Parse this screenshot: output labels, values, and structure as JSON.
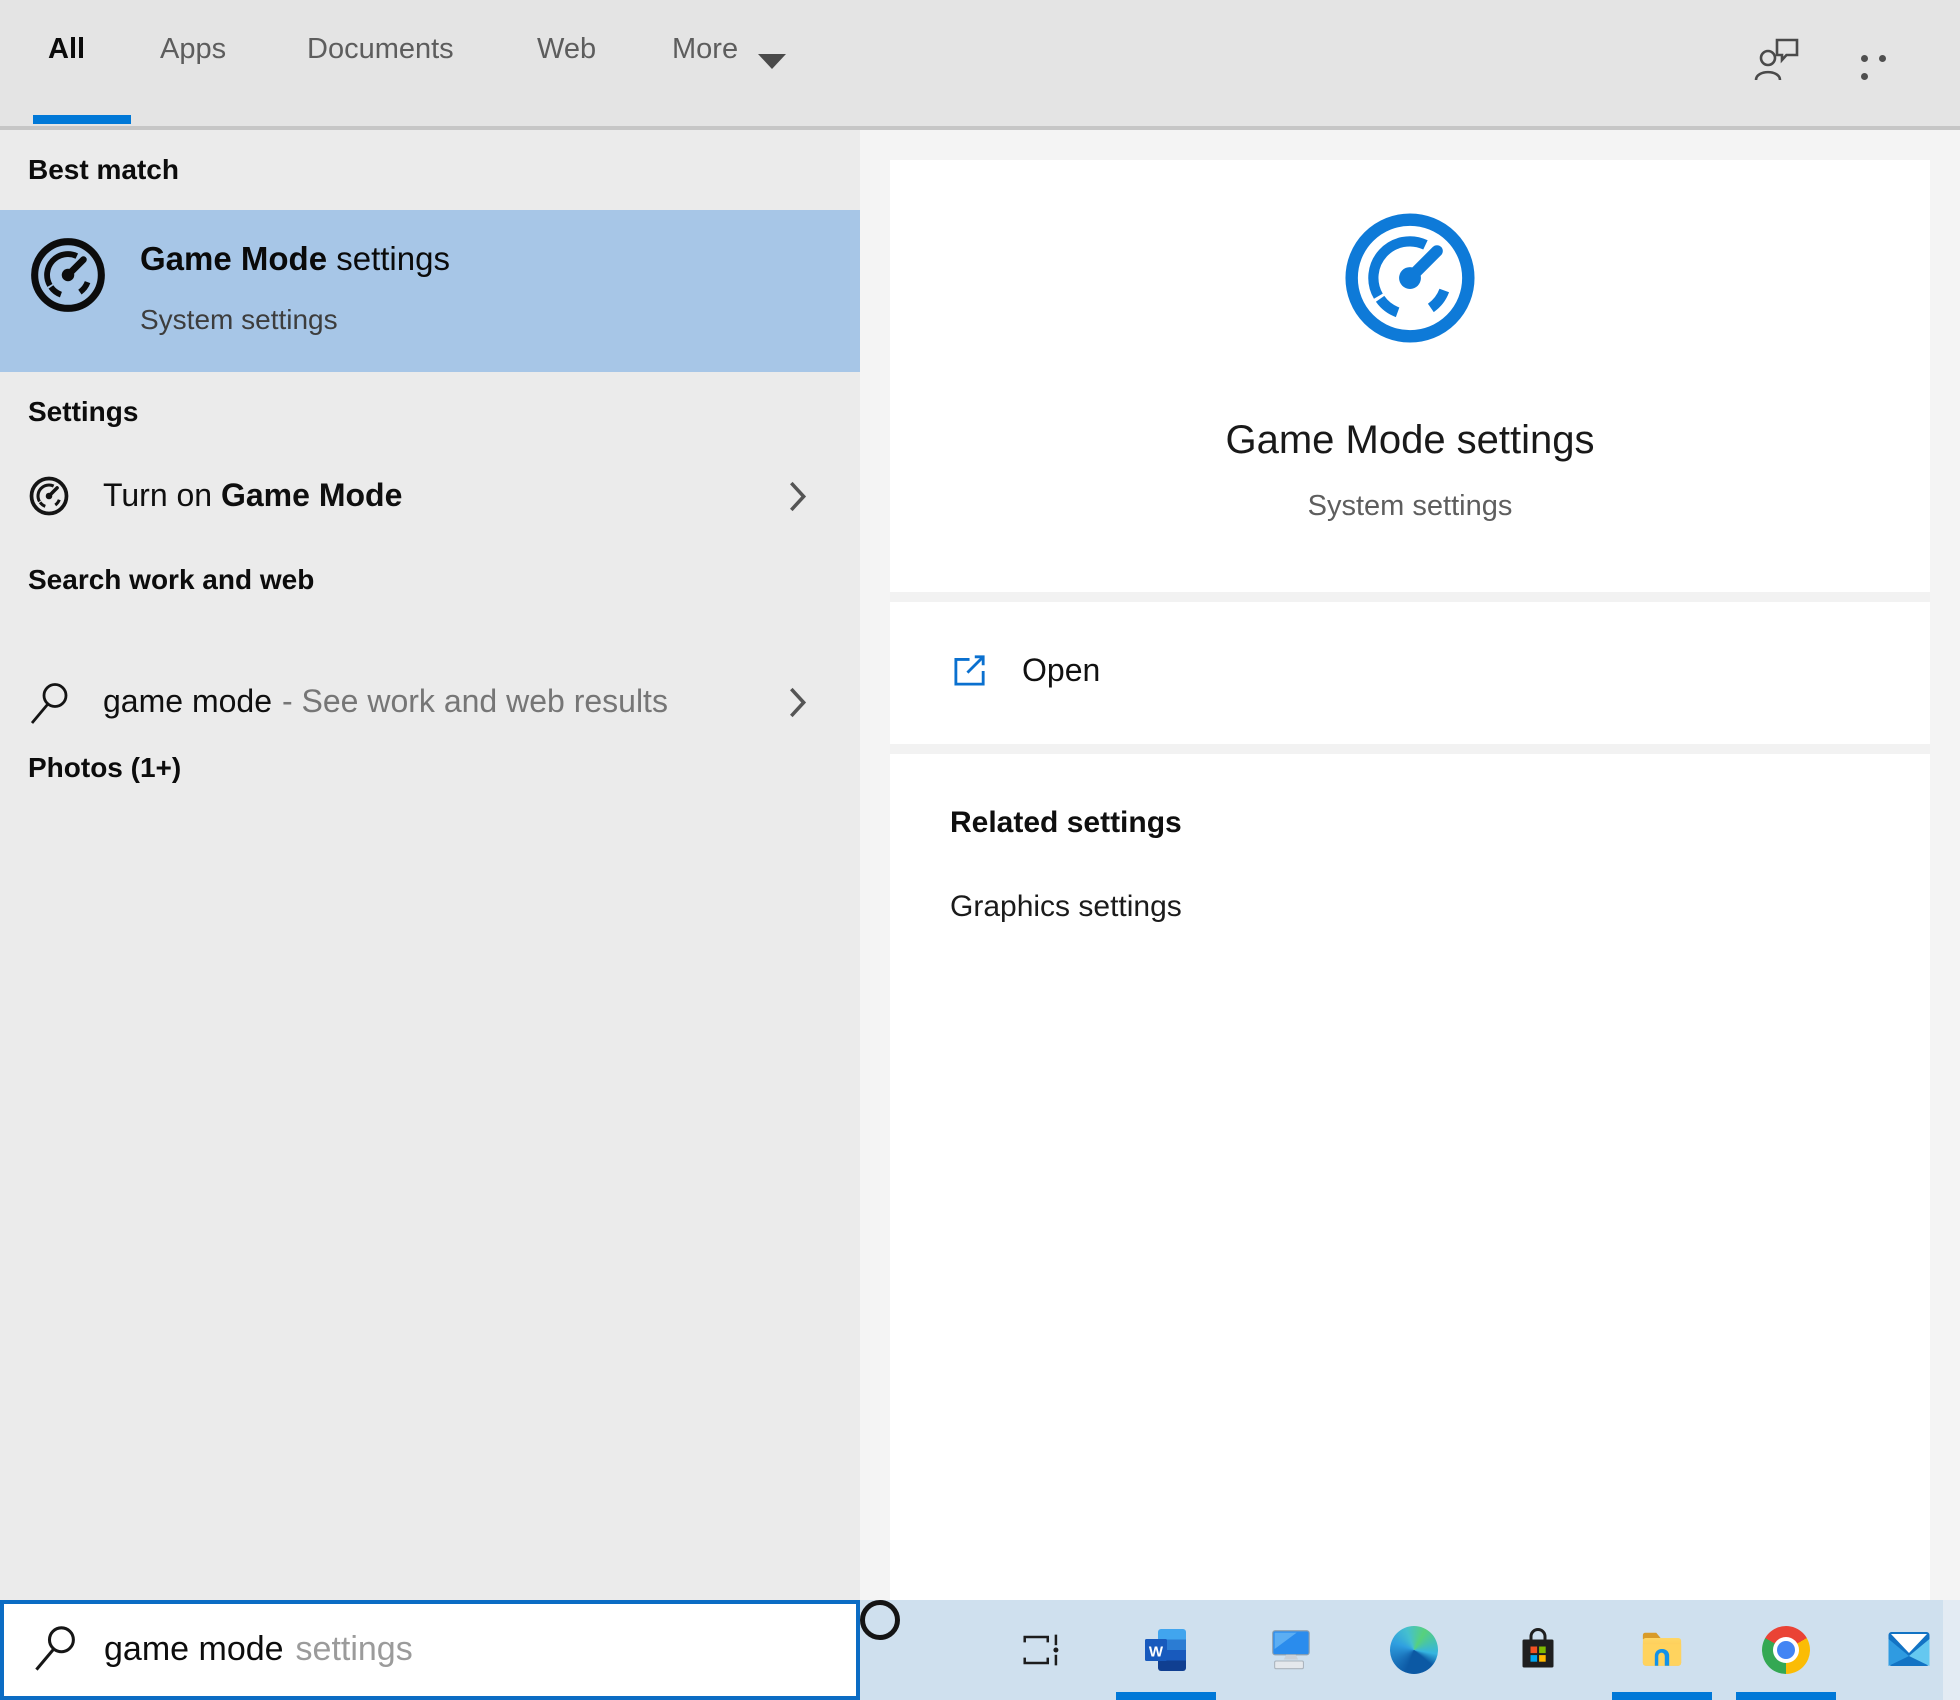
{
  "header": {
    "tabs": [
      {
        "label": "All",
        "active": true
      },
      {
        "label": "Apps",
        "active": false
      },
      {
        "label": "Documents",
        "active": false
      },
      {
        "label": "Web",
        "active": false
      },
      {
        "label": "More",
        "active": false
      }
    ]
  },
  "left_panel": {
    "best_match_header": "Best match",
    "best_match": {
      "title_bold": "Game Mode",
      "title_rest": " settings",
      "subtitle": "System settings"
    },
    "settings_header": "Settings",
    "settings_item": {
      "prefix": "Turn on ",
      "bold": "Game Mode"
    },
    "web_header": "Search work and web",
    "web_item": {
      "query": "game mode",
      "hint": "- See work and web results"
    },
    "photos_header": "Photos (1+)"
  },
  "preview": {
    "title": "Game Mode settings",
    "subtitle": "System settings",
    "open_label": "Open",
    "related_header": "Related settings",
    "related_link": "Graphics settings"
  },
  "search_box": {
    "typed": "game mode",
    "suggestion": "settings"
  },
  "taskbar": {
    "icons": [
      "cortana",
      "task-view",
      "word",
      "my-computer",
      "edge",
      "microsoft-store",
      "file-explorer",
      "chrome",
      "mail"
    ],
    "running_indicators": [
      "word",
      "file-explorer",
      "chrome"
    ]
  },
  "colors": {
    "accent": "#0078d7",
    "selection_highlight": "#a7c6e7",
    "gauge_blue": "#0e7ad8",
    "taskbar_bg": "#cfe0ee",
    "search_border": "#0b6cc4"
  }
}
